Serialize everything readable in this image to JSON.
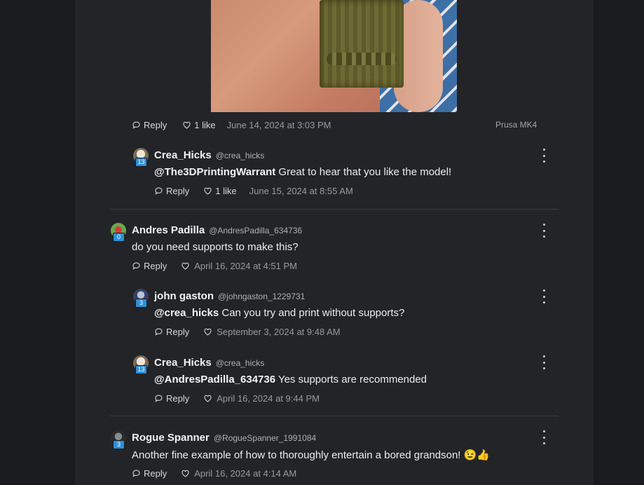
{
  "post": {
    "printer": "Prusa MK4"
  },
  "top_actions": {
    "reply": "Reply",
    "likes": "1 like",
    "date": "June 14, 2024 at 3:03 PM"
  },
  "comments": [
    {
      "name": "Crea_Hicks",
      "handle": "@crea_hicks",
      "badge": "13",
      "mention": "@The3DPrintingWarrant",
      "text": " Great to hear that you like the model!",
      "reply": "Reply",
      "likes": "1 like",
      "date": "June 15, 2024 at 8:55 AM"
    },
    {
      "name": "Andres Padilla",
      "handle": "@AndresPadilla_634736",
      "badge": "0",
      "mention": "",
      "text": "do you need supports to make this?",
      "reply": "Reply",
      "date": "April 16, 2024 at 4:51 PM"
    },
    {
      "name": "john gaston",
      "handle": "@johngaston_1229731",
      "badge": "3",
      "mention": "@crea_hicks",
      "text": " Can you try and print without supports?",
      "reply": "Reply",
      "date": "September 3, 2024 at 9:48 AM"
    },
    {
      "name": "Crea_Hicks",
      "handle": "@crea_hicks",
      "badge": "13",
      "mention": "@AndresPadilla_634736",
      "text": " Yes supports are recommended",
      "reply": "Reply",
      "date": "April 16, 2024 at 9:44 PM"
    },
    {
      "name": "Rogue Spanner",
      "handle": "@RogueSpanner_1991084",
      "badge": "3",
      "mention": "",
      "text": "Another fine example of how to thoroughly entertain a bored grandson! ",
      "emojis": "😉👍",
      "reply": "Reply",
      "date": "April 16, 2024 at 4:14 AM"
    }
  ],
  "icons": {
    "reply": "speech-bubble-icon",
    "like": "heart-icon",
    "more": "kebab-menu-icon"
  },
  "colors": {
    "background": "#1a1b1e",
    "panel": "#232428",
    "badge": "#2f8fd8"
  }
}
